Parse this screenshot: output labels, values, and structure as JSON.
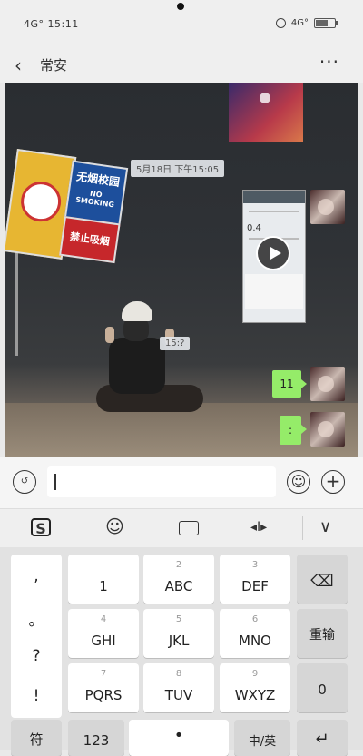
{
  "status_bar": {
    "left_text": "4G° 15:11",
    "right_text": "4G°"
  },
  "nav": {
    "back_icon": "‹",
    "title": "常安",
    "more_icon": "···"
  },
  "chat": {
    "timestamp": "5月18日 下午15:05",
    "video_value": "0.4",
    "small_label": "15:?",
    "messages": [
      {
        "text": "11"
      },
      {
        "text": ":"
      }
    ]
  },
  "input_bar": {
    "voice_icon": "↺",
    "emoji_icon": "☺",
    "plus_icon": "+"
  },
  "keyboard_toolbar": {
    "logo": "S",
    "emoji_icon": "☺",
    "keyboard_icon": "⌨",
    "cursor_icon": "◂I▸",
    "collapse_icon": "∨"
  },
  "keyboard": {
    "symbols": [
      ",",
      "。",
      "?",
      "!"
    ],
    "keys": [
      {
        "sub": "",
        "main": "1"
      },
      {
        "sub": "2",
        "main": "ABC"
      },
      {
        "sub": "3",
        "main": "DEF"
      },
      {
        "sub": "4",
        "main": "GHI"
      },
      {
        "sub": "5",
        "main": "JKL"
      },
      {
        "sub": "6",
        "main": "MNO"
      },
      {
        "sub": "7",
        "main": "PQRS"
      },
      {
        "sub": "8",
        "main": "TUV"
      },
      {
        "sub": "9",
        "main": "WXYZ"
      }
    ],
    "backspace_icon": "⌫",
    "reenter_label": "重输",
    "zero_label": "0",
    "symbol_label": "符",
    "num_label": "123",
    "mic_icon": "•",
    "lang_label": "中/英",
    "enter_icon": "↵"
  },
  "sign": {
    "blue_text": "无烟校园",
    "blue_sub": "NO SMOKING",
    "red_text": "禁止吸烟"
  }
}
